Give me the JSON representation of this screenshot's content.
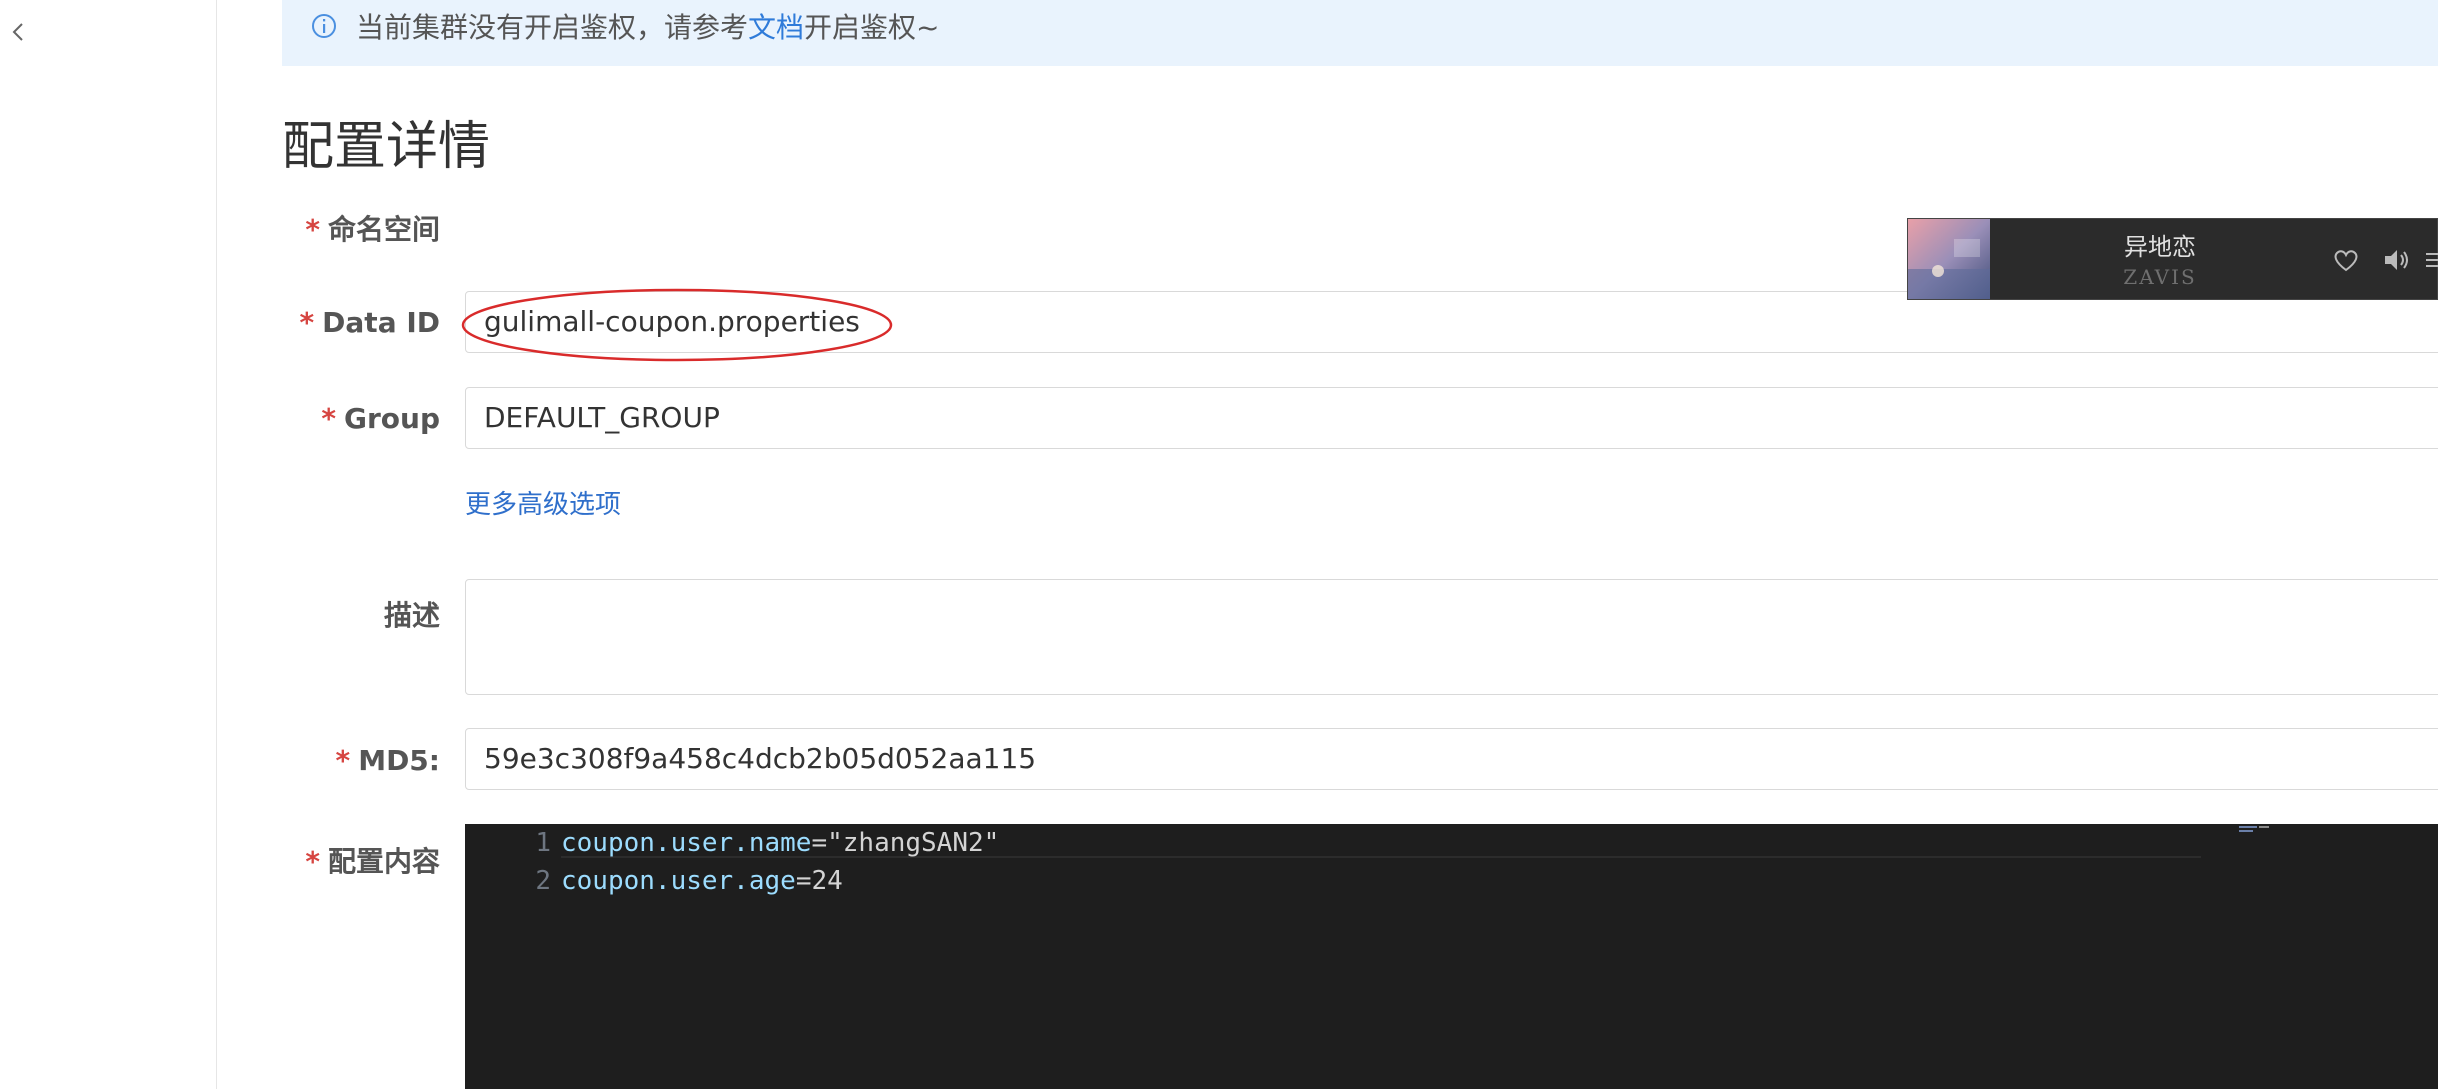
{
  "notice": {
    "text_before": "当前集群没有开启鉴权，请参考",
    "link": "文档",
    "text_after": "开启鉴权~"
  },
  "page_title": "配置详情",
  "form": {
    "namespace_label": "命名空间",
    "data_id_label": "Data ID",
    "data_id_value": "gulimall-coupon.properties",
    "group_label": "Group",
    "group_value": "DEFAULT_GROUP",
    "advanced_link": "更多高级选项",
    "description_label": "描述",
    "description_value": "",
    "md5_label": "MD5:",
    "md5_value": "59e3c308f9a458c4dcb2b05d052aa115",
    "content_label": "配置内容",
    "required_mark": "*"
  },
  "editor": {
    "lines": [
      {
        "number": "1",
        "key": "coupon.user.name",
        "op": "=",
        "value": "\"zhangSAN2\""
      },
      {
        "number": "2",
        "key": "coupon.user.age",
        "op": "=",
        "value": "24"
      }
    ]
  },
  "player": {
    "song": "异地恋",
    "artist": "ZAVIS",
    "icons": [
      "heart-icon",
      "volume-icon",
      "playlist-icon"
    ]
  },
  "colors": {
    "required": "#d64541",
    "link": "#2f7bd9",
    "notice_bg": "#e9f3fd",
    "editor_bg": "#1e1e1e",
    "annotation": "#d92b2b"
  }
}
